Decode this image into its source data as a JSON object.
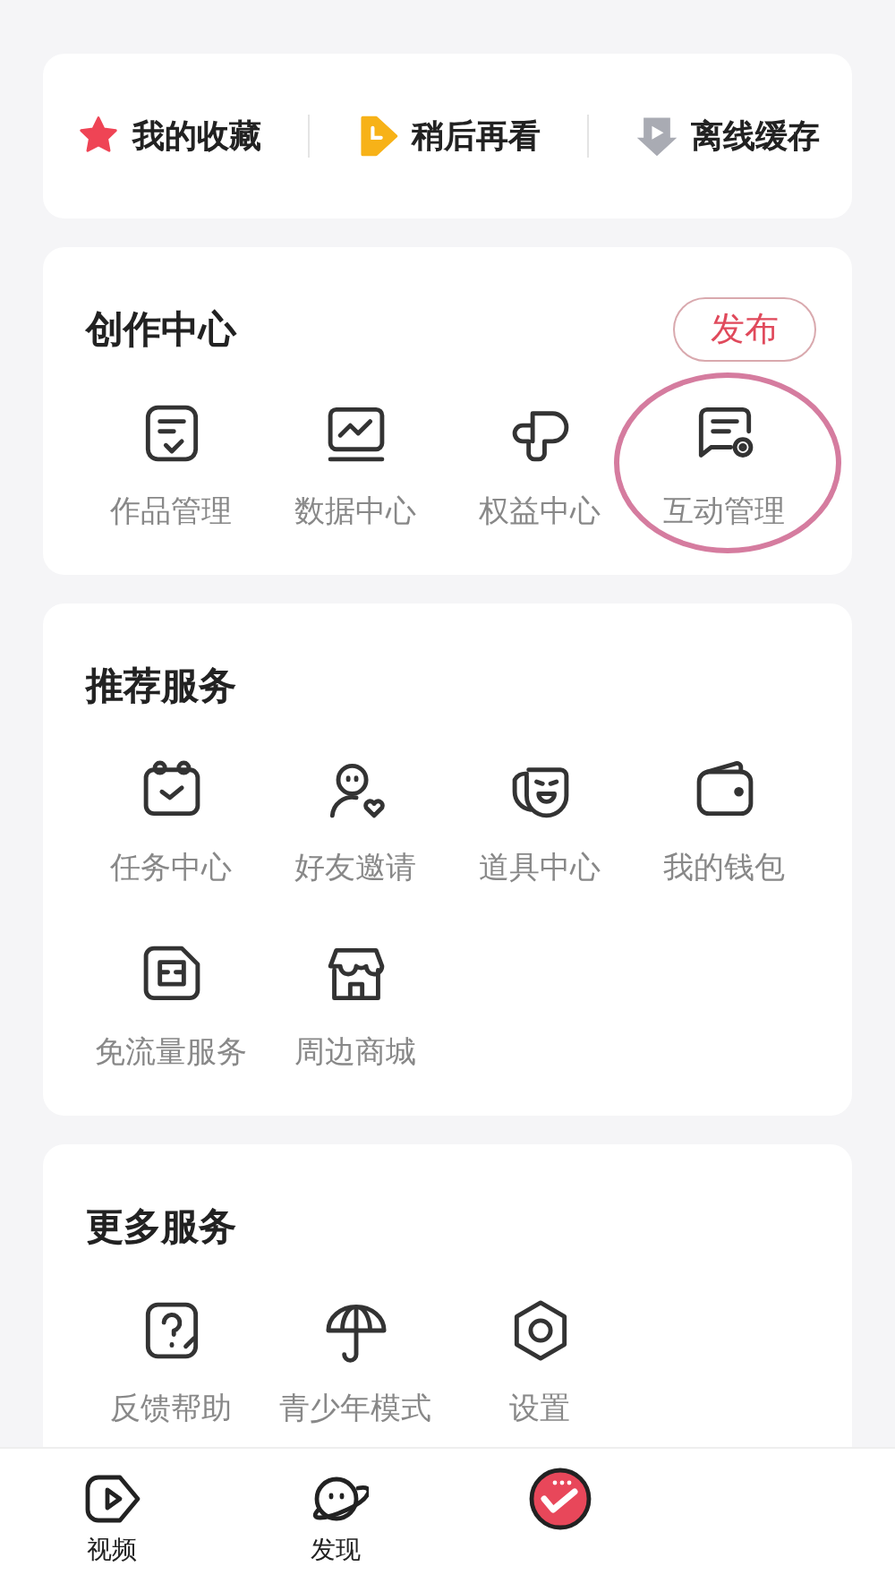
{
  "quick_links": [
    {
      "label": "我的收藏"
    },
    {
      "label": "稍后再看"
    },
    {
      "label": "离线缓存"
    }
  ],
  "sections": [
    {
      "title": "创作中心",
      "action": "发布",
      "items": [
        {
          "label": "作品管理",
          "highlighted": false
        },
        {
          "label": "数据中心",
          "highlighted": false
        },
        {
          "label": "权益中心",
          "highlighted": false
        },
        {
          "label": "互动管理",
          "highlighted": true
        }
      ]
    },
    {
      "title": "推荐服务",
      "items": [
        {
          "label": "任务中心",
          "highlighted": false
        },
        {
          "label": "好友邀请",
          "highlighted": false
        },
        {
          "label": "道具中心",
          "highlighted": false
        },
        {
          "label": "我的钱包",
          "highlighted": false
        },
        {
          "label": "免流量服务",
          "highlighted": false
        },
        {
          "label": "周边商城",
          "highlighted": false
        }
      ]
    },
    {
      "title": "更多服务",
      "items": [
        {
          "label": "反馈帮助",
          "highlighted": false
        },
        {
          "label": "青少年模式",
          "highlighted": false
        },
        {
          "label": "设置",
          "highlighted": false
        }
      ]
    }
  ],
  "tab_bar": [
    {
      "kind": "labeled",
      "label": "视频"
    },
    {
      "kind": "labeled",
      "label": "发现"
    },
    {
      "kind": "icon"
    }
  ]
}
